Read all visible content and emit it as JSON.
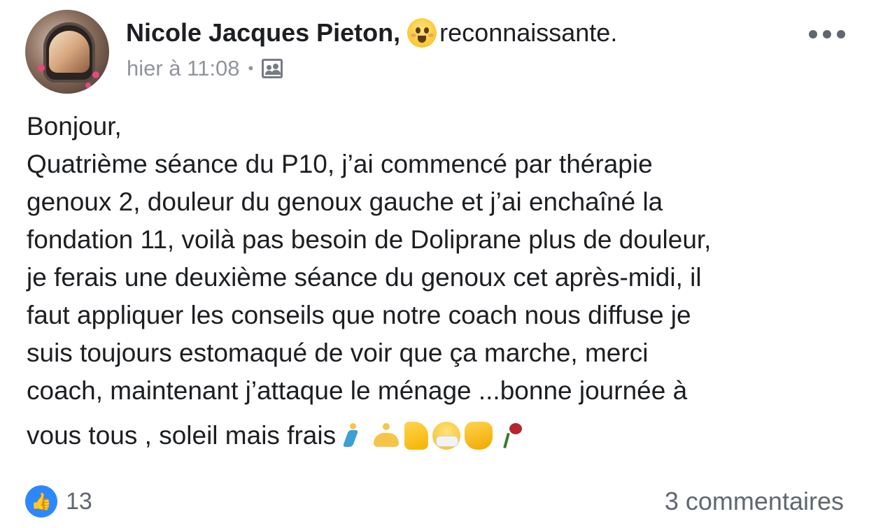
{
  "post": {
    "author": "Nicole Jacques Pieton",
    "feeling_icon": "grateful-face-emoji",
    "feeling_text": "reconnaissante.",
    "timestamp": "hier à 11:08",
    "audience_icon": "friends-audience-icon",
    "more_icon": "more-options-icon",
    "body_lines": [
      "Bonjour,",
      "Quatrième séance du P10, j’ai commencé par thérapie",
      "genoux 2, douleur du genoux gauche et j’ai enchaîné la",
      "fondation 11, voilà pas besoin de Doliprane plus de douleur,",
      "je ferais une deuxième séance du genoux cet après-midi, il",
      "faut appliquer les conseils que notre coach nous diffuse je",
      "suis toujours estomaqué de voir que ça marche, merci",
      "coach, maintenant j’attaque le ménage ...bonne journée à"
    ],
    "last_line_text": "vous tous , soleil mais frais",
    "last_line_emojis": [
      "runner-emoji",
      "yoga-emoji",
      "flexed-biceps-emoji",
      "face-with-mask-emoji",
      "waving-hand-emoji",
      "wilted-rose-emoji"
    ],
    "reactions": {
      "icon": "like-thumbs-up-icon",
      "count": "13"
    },
    "comments_label": "3 commentaires"
  },
  "colors": {
    "text_primary": "#1c1e21",
    "text_secondary": "#90949c",
    "like_blue": "#2d88ff"
  }
}
